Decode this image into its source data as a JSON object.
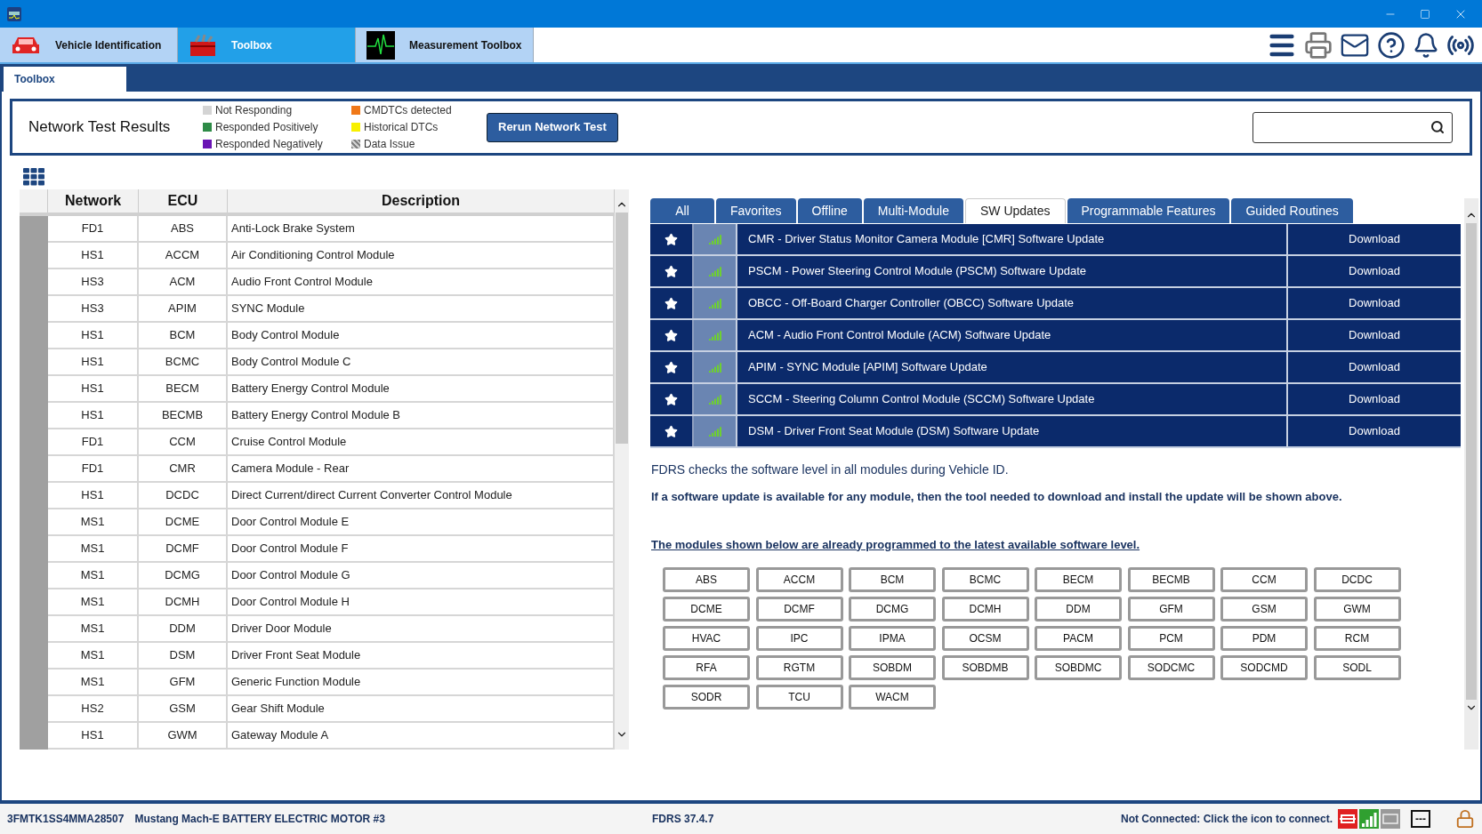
{
  "main_tabs": [
    {
      "label": "Vehicle Identification",
      "kind": "car",
      "selected": false
    },
    {
      "label": "Toolbox",
      "kind": "toolbox",
      "selected": true
    },
    {
      "label": "Measurement Toolbox",
      "kind": "scope",
      "selected": false
    }
  ],
  "sub_tabs": [
    {
      "label": "Toolbox",
      "selected": true
    }
  ],
  "network_test": {
    "title": "Network Test Results",
    "legend": [
      {
        "label": "Not Responding",
        "color": "#d4d4d4",
        "kind": "solid"
      },
      {
        "label": "Responded Positively",
        "color": "#2e8b47",
        "kind": "solid"
      },
      {
        "label": "Responded Negatively",
        "color": "#6a14b4",
        "kind": "solid"
      },
      {
        "label": "CMDTCs detected",
        "color": "#f07818",
        "kind": "solid"
      },
      {
        "label": "Historical DTCs",
        "color": "#f8f000",
        "kind": "solid"
      },
      {
        "label": "Data Issue",
        "color": "#808080",
        "kind": "hatched"
      }
    ],
    "button": "Rerun Network Test"
  },
  "table": {
    "columns": [
      "Network",
      "ECU",
      "Description"
    ],
    "rows": [
      [
        "FD1",
        "ABS",
        "Anti-Lock Brake System"
      ],
      [
        "HS1",
        "ACCM",
        "Air Conditioning Control Module"
      ],
      [
        "HS3",
        "ACM",
        "Audio Front Control Module"
      ],
      [
        "HS3",
        "APIM",
        "SYNC Module"
      ],
      [
        "HS1",
        "BCM",
        "Body Control Module"
      ],
      [
        "HS1",
        "BCMC",
        "Body Control Module C"
      ],
      [
        "HS1",
        "BECM",
        "Battery Energy Control Module"
      ],
      [
        "HS1",
        "BECMB",
        "Battery Energy Control Module B"
      ],
      [
        "FD1",
        "CCM",
        "Cruise Control Module"
      ],
      [
        "FD1",
        "CMR",
        "Camera Module - Rear"
      ],
      [
        "HS1",
        "DCDC",
        "Direct Current/direct Current Converter Control Module"
      ],
      [
        "MS1",
        "DCME",
        "Door Control Module E"
      ],
      [
        "MS1",
        "DCMF",
        "Door Control Module F"
      ],
      [
        "MS1",
        "DCMG",
        "Door Control Module G"
      ],
      [
        "MS1",
        "DCMH",
        "Door Control Module H"
      ],
      [
        "MS1",
        "DDM",
        "Driver Door Module"
      ],
      [
        "MS1",
        "DSM",
        "Driver Front Seat Module"
      ],
      [
        "MS1",
        "GFM",
        "Generic Function Module"
      ],
      [
        "HS2",
        "GSM",
        "Gear Shift Module"
      ],
      [
        "HS1",
        "GWM",
        "Gateway Module A"
      ]
    ]
  },
  "tool_tabs": [
    {
      "label": "All",
      "selected": false
    },
    {
      "label": "Favorites",
      "selected": false
    },
    {
      "label": "Offline",
      "selected": false
    },
    {
      "label": "Multi-Module",
      "selected": false
    },
    {
      "label": "SW Updates",
      "selected": true
    },
    {
      "label": "Programmable Features",
      "selected": false
    },
    {
      "label": "Guided Routines",
      "selected": false
    }
  ],
  "updates": [
    {
      "title": "CMR - Driver Status Monitor Camera Module [CMR] Software Update",
      "action": "Download"
    },
    {
      "title": "PSCM - Power Steering Control Module (PSCM) Software Update",
      "action": "Download"
    },
    {
      "title": "OBCC - Off-Board Charger Controller (OBCC) Software Update",
      "action": "Download"
    },
    {
      "title": "ACM - Audio Front Control Module (ACM) Software Update",
      "action": "Download"
    },
    {
      "title": "APIM - SYNC Module [APIM] Software Update",
      "action": "Download"
    },
    {
      "title": "SCCM - Steering Column Control Module (SCCM) Software Update",
      "action": "Download"
    },
    {
      "title": "DSM - Driver Front Seat Module (DSM) Software Update",
      "action": "Download"
    }
  ],
  "info": "FDRS checks the software level in all modules during Vehicle ID.",
  "info_bold": "If a software update is available for any module, then the tool needed to download and install the update will be shown above.",
  "modules_heading": "The modules shown below are already programmed to the latest available software level.",
  "modules": [
    "ABS",
    "ACCM",
    "BCM",
    "BCMC",
    "BECM",
    "BECMB",
    "CCM",
    "DCDC",
    "DCME",
    "DCMF",
    "DCMG",
    "DCMH",
    "DDM",
    "GFM",
    "GSM",
    "GWM",
    "HVAC",
    "IPC",
    "IPMA",
    "OCSM",
    "PACM",
    "PCM",
    "PDM",
    "RCM",
    "RFA",
    "RGTM",
    "SOBDM",
    "SOBDMB",
    "SOBDMC",
    "SODCMC",
    "SODCMD",
    "SODL",
    "SODR",
    "TCU",
    "WACM"
  ],
  "status_bar": {
    "vin": "3FMTK1SS4MMA28507",
    "vehicle": "Mustang Mach-E BATTERY ELECTRIC MOTOR #3",
    "version": "FDRS 37.4.7",
    "connection": "Not Connected: Click the icon to connect.",
    "indicator": "---"
  }
}
